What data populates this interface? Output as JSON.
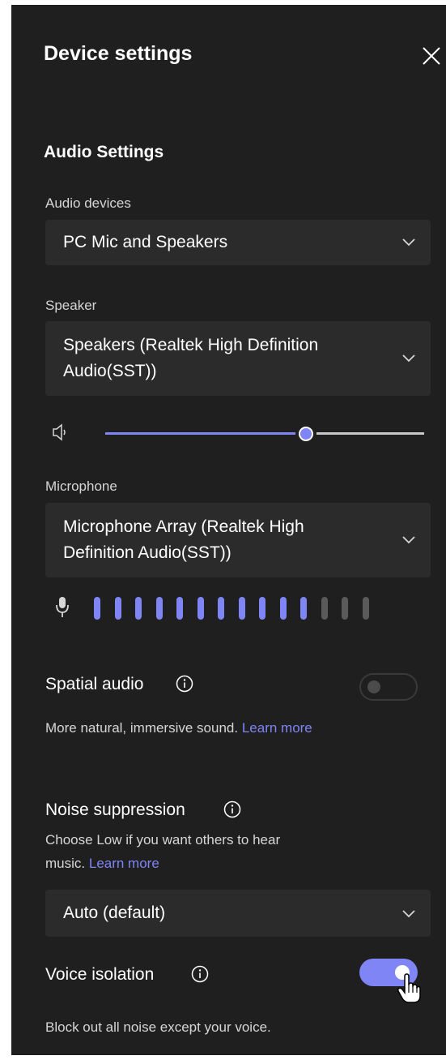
{
  "header": {
    "title": "Device settings",
    "close_icon": "close-icon"
  },
  "audio_settings": {
    "section_title": "Audio Settings",
    "audio_devices": {
      "label": "Audio devices",
      "value": "PC Mic and Speakers"
    },
    "speaker": {
      "label": "Speaker",
      "value_line1": "Speakers (Realtek High Definition",
      "value_line2": "Audio(SST))",
      "volume_fraction": 0.63
    },
    "microphone": {
      "label": "Microphone",
      "value_line1": "Microphone Array (Realtek High",
      "value_line2": "Definition Audio(SST))",
      "level_active_bars": 11,
      "level_total_bars": 14
    },
    "spatial_audio": {
      "label": "Spatial audio",
      "enabled": false,
      "description": "More natural, immersive sound.",
      "learn_more": "Learn more"
    },
    "noise_suppression": {
      "label": "Noise suppression",
      "description_line1": "Choose Low if you want others to hear",
      "description_line2": "music.",
      "learn_more": "Learn more",
      "value": "Auto (default)"
    },
    "voice_isolation": {
      "label": "Voice isolation",
      "enabled": true,
      "description": "Block out all noise except your voice."
    }
  },
  "colors": {
    "panel_bg": "#1f1f1f",
    "dropdown_bg": "#2b2b2b",
    "accent": "#7f85f5",
    "inactive_bar": "#5a5a5a"
  }
}
